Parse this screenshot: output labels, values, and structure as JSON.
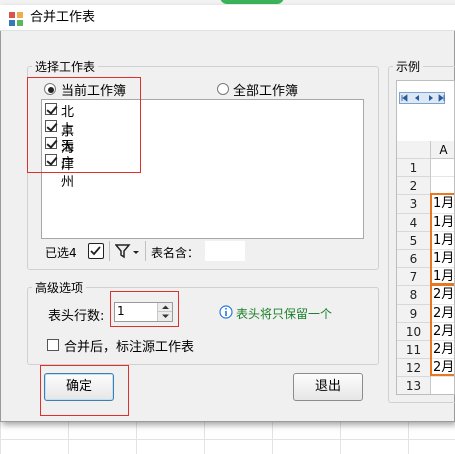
{
  "window": {
    "title": "合并工作表"
  },
  "select_group": {
    "legend": "选择工作表",
    "radio_current": "当前工作簿",
    "radio_all": "全部工作簿",
    "sheets": [
      {
        "name": "北京",
        "checked": true
      },
      {
        "name": "上海",
        "checked": true
      },
      {
        "name": "天津",
        "checked": true
      },
      {
        "name": "广州",
        "checked": true
      }
    ],
    "selected_count": "已选4",
    "sheet_name_contains_label": "表名含：",
    "sheet_name_contains_value": ""
  },
  "advanced_group": {
    "legend": "高级选项",
    "header_rows_label": "表头行数:",
    "header_rows_value": "1",
    "info_text": "表头将只保留一个",
    "mark_source_label": "合并后，标注源工作表",
    "mark_source_checked": false
  },
  "buttons": {
    "ok": "确定",
    "cancel": "退出"
  },
  "example": {
    "legend": "示例",
    "col_header": "A",
    "rows": [
      {
        "num": "1",
        "value": ""
      },
      {
        "num": "2",
        "value": ""
      },
      {
        "num": "3",
        "value": "1月"
      },
      {
        "num": "4",
        "value": "1月"
      },
      {
        "num": "5",
        "value": "1月"
      },
      {
        "num": "6",
        "value": "1月"
      },
      {
        "num": "7",
        "value": "1月"
      },
      {
        "num": "8",
        "value": "2月"
      },
      {
        "num": "9",
        "value": "2月"
      },
      {
        "num": "10",
        "value": "2月"
      },
      {
        "num": "11",
        "value": "2月"
      },
      {
        "num": "12",
        "value": "2月"
      },
      {
        "num": "13",
        "value": ""
      }
    ]
  },
  "colors": {
    "highlight_red": "#e0302e",
    "example_orange": "#e87722",
    "info_green": "#1a7f2a",
    "info_icon_blue": "#2a7ad6"
  }
}
